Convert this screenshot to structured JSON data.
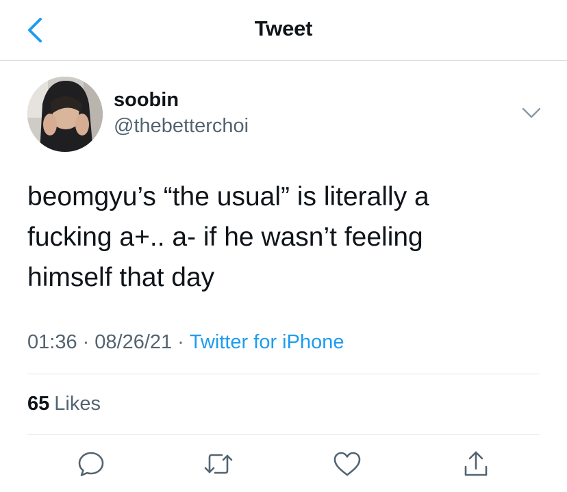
{
  "header": {
    "title": "Tweet",
    "back_icon": "chevron-left-icon"
  },
  "author": {
    "name": "soobin",
    "handle": "@thebetterchoi"
  },
  "tweet": {
    "text": "beomgyu’s “the usual” is literally a\nfucking a+.. a- if he wasn’t feeling\nhimself that day"
  },
  "meta": {
    "time": "01:36",
    "separator": "·",
    "date": "08/26/21",
    "source": "Twitter for iPhone"
  },
  "stats": {
    "likes_count": "65",
    "likes_label": "Likes"
  },
  "actions": [
    "reply-icon",
    "retweet-icon",
    "like-icon",
    "share-icon"
  ],
  "colors": {
    "accent": "#1d9bf0",
    "secondary_text": "#536471",
    "primary_text": "#0f1419"
  }
}
